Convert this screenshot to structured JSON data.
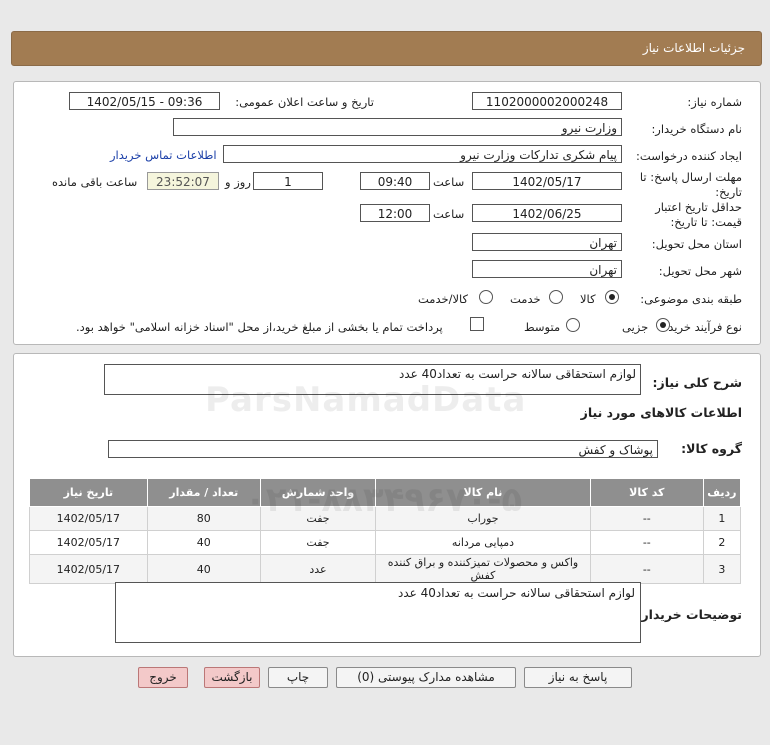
{
  "header": {
    "title": "جزئیات اطلاعات نیاز"
  },
  "form": {
    "need_number_label": "شماره نیاز:",
    "need_number": "1102000002000248",
    "announce_label": "تاریخ و ساعت اعلان عمومی:",
    "announce_value": "1402/05/15 - 09:36",
    "buyer_org_label": "نام دستگاه خریدار:",
    "buyer_org": "وزارت نیرو",
    "creator_label": "ایجاد کننده درخواست:",
    "creator": "پیام شکری تدارکات وزارت نیرو",
    "contact_link": "اطلاعات تماس خریدار",
    "deadline_label_1": "مهلت ارسال پاسخ: تا",
    "deadline_label_2": "تاریخ:",
    "deadline_date": "1402/05/17",
    "time_label": "ساعت",
    "deadline_time": "09:40",
    "days_value": "1",
    "days_label": "روز و",
    "remaining_time": "23:52:07",
    "remaining_label": "ساعت باقی مانده",
    "validity_label_1": "حداقل تاریخ اعتبار",
    "validity_label_2": "قیمت: تا تاریخ:",
    "validity_date": "1402/06/25",
    "validity_time": "12:00",
    "province_label": "استان محل تحویل:",
    "province": "تهران",
    "city_label": "شهر محل تحویل:",
    "city": "تهران",
    "category_label": "طبقه بندی موضوعی:",
    "category_options": [
      "کالا",
      "خدمت",
      "کالا/خدمت"
    ],
    "process_label": "نوع فرآیند خرید :",
    "process_options": [
      "جزیی",
      "متوسط"
    ],
    "payment_note": "پرداخت تمام یا بخشی از مبلغ خرید،از محل \"اسناد خزانه اسلامی\" خواهد بود."
  },
  "summary": {
    "desc_label": "شرح کلی نیاز:",
    "desc_value": "لوازم استحقاقی سالانه حراست به تعداد40 عدد",
    "goods_info_title": "اطلاعات کالاهای مورد نیاز",
    "group_label": "گروه کالا:",
    "group_value": "پوشاک و کفش"
  },
  "table": {
    "headers": [
      "ردیف",
      "کد کالا",
      "نام کالا",
      "واحد شمارش",
      "تعداد / مقدار",
      "تاریخ نیاز"
    ],
    "rows": [
      [
        "1",
        "--",
        "جوراب",
        "جفت",
        "80",
        "1402/05/17"
      ],
      [
        "2",
        "--",
        "دمپایی مردانه",
        "جفت",
        "40",
        "1402/05/17"
      ],
      [
        "3",
        "--",
        "واکس و محصولات تمیزکننده و براق کننده کفش",
        "عدد",
        "40",
        "1402/05/17"
      ]
    ]
  },
  "buyer_notes": {
    "label": "توضیحات خریدار:",
    "value": "لوازم استحقاقی سالانه حراست به تعداد40 عدد"
  },
  "buttons": {
    "reply": "پاسخ به نیاز",
    "attachments": "مشاهده مدارک پیوستی (0)",
    "print": "چاپ",
    "back": "بازگشت",
    "exit": "خروج"
  },
  "watermark": {
    "text": "ParsNamadData",
    "phone": "۰۲۱-۸۸۳۴۹۶۷۰-۵"
  }
}
